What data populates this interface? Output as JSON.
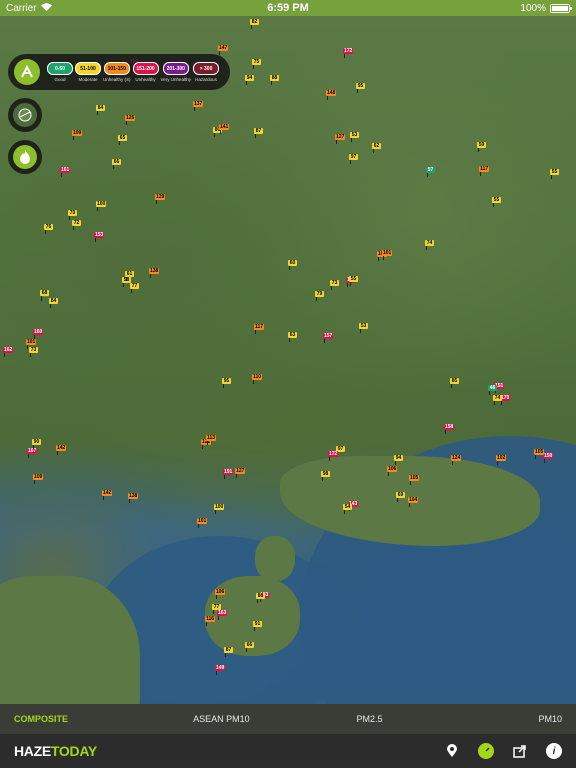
{
  "status_bar": {
    "carrier": "Carrier",
    "time": "6:59 PM",
    "battery": "100%"
  },
  "legend": {
    "items": [
      {
        "range": "0-50",
        "label": "Good",
        "color": "#1fa36b"
      },
      {
        "range": "51-100",
        "label": "Moderate",
        "color": "#f2d52a"
      },
      {
        "range": "101-150",
        "label": "Unhealthy (S)",
        "color": "#f28a1e"
      },
      {
        "range": "151-200",
        "label": "Unhealthy",
        "color": "#d8154b"
      },
      {
        "range": "201-300",
        "label": "Very Unhealthy",
        "color": "#7a1a8f"
      },
      {
        "range": "> 300",
        "label": "Hazardous",
        "color": "#7e1b2b"
      }
    ]
  },
  "map_buttons": [
    {
      "name": "satellite-layer-icon"
    },
    {
      "name": "fire-layer-icon"
    }
  ],
  "source_tabs": [
    {
      "label": "COMPOSITE",
      "active": true
    },
    {
      "label": "ASEAN PM10",
      "active": false
    },
    {
      "label": "PM2.5",
      "active": false
    },
    {
      "label": "PM10",
      "active": false
    }
  ],
  "brand": {
    "part1": "HAZE",
    "part2": "TODAY"
  },
  "bottom_icons": [
    "location-pin-icon",
    "gauge-icon",
    "share-icon",
    "info-icon"
  ],
  "markers": [
    [
      "65",
      "mod"
    ],
    [
      "147",
      "usg"
    ],
    [
      "57",
      "good"
    ],
    [
      "84",
      "mod"
    ],
    [
      "155",
      "unh"
    ],
    [
      "143",
      "unh"
    ],
    [
      "183",
      "unh"
    ],
    [
      "170",
      "unh"
    ],
    [
      "66",
      "good"
    ],
    [
      "122",
      "usg"
    ],
    [
      "85",
      "mod"
    ],
    [
      "53",
      "mod"
    ],
    [
      "97",
      "mod"
    ],
    [
      "129",
      "usg"
    ],
    [
      "79",
      "mod"
    ],
    [
      "106",
      "usg"
    ],
    [
      "149",
      "unh"
    ],
    [
      "74",
      "mod"
    ],
    [
      "160",
      "unh"
    ],
    [
      "138",
      "usg"
    ],
    [
      "84",
      "mod"
    ],
    [
      "80",
      "mod"
    ],
    [
      "104",
      "usg"
    ],
    [
      "100",
      "mod"
    ],
    [
      "55",
      "mod"
    ],
    [
      "69",
      "mod"
    ],
    [
      "77",
      "mod"
    ],
    [
      "151",
      "unh"
    ],
    [
      "162",
      "unh"
    ],
    [
      "191",
      "unh"
    ],
    [
      "137",
      "usg"
    ],
    [
      "88",
      "mod"
    ],
    [
      "74",
      "mod"
    ],
    [
      "153",
      "unh"
    ],
    [
      "60",
      "mod"
    ],
    [
      "94",
      "mod"
    ],
    [
      "87",
      "mod"
    ],
    [
      "150",
      "unh"
    ],
    [
      "142",
      "usg"
    ],
    [
      "127",
      "usg"
    ],
    [
      "153",
      "unh"
    ],
    [
      "75",
      "mod"
    ],
    [
      "62",
      "mod"
    ],
    [
      "58",
      "mod"
    ],
    [
      "63",
      "mod"
    ],
    [
      "98",
      "mod"
    ],
    [
      "91",
      "mod"
    ],
    [
      "124",
      "usg"
    ],
    [
      "167",
      "unh"
    ],
    [
      "113",
      "usg"
    ],
    [
      "161",
      "unh"
    ],
    [
      "172",
      "unh"
    ],
    [
      "148",
      "usg"
    ],
    [
      "61",
      "mod"
    ],
    [
      "53",
      "mod"
    ],
    [
      "54",
      "mod"
    ],
    [
      "106",
      "usg"
    ],
    [
      "85",
      "mod"
    ],
    [
      "90",
      "mod"
    ],
    [
      "110",
      "usg"
    ],
    [
      "145",
      "unh"
    ],
    [
      "94",
      "mod"
    ],
    [
      "127",
      "usg"
    ],
    [
      "70",
      "mod"
    ],
    [
      "101",
      "usg"
    ],
    [
      "97",
      "mod"
    ],
    [
      "88",
      "mod"
    ],
    [
      "46",
      "good"
    ],
    [
      "73",
      "mod"
    ],
    [
      "142",
      "usg"
    ],
    [
      "66",
      "mod"
    ],
    [
      "87",
      "mod"
    ],
    [
      "55",
      "mod"
    ],
    [
      "72",
      "mod"
    ],
    [
      "117",
      "usg"
    ],
    [
      "172",
      "unh"
    ],
    [
      "163",
      "unh"
    ],
    [
      "158",
      "unh"
    ],
    [
      "101",
      "usg"
    ],
    [
      "101",
      "usg"
    ],
    [
      "126",
      "usg"
    ],
    [
      "141",
      "usg"
    ],
    [
      "117",
      "usg"
    ],
    [
      "138",
      "usg"
    ],
    [
      "157",
      "unh"
    ],
    [
      "105",
      "usg"
    ],
    [
      "66",
      "mod"
    ],
    [
      "105",
      "usg"
    ],
    [
      "109",
      "usg"
    ],
    [
      "100",
      "mod"
    ],
    [
      "97",
      "mod"
    ],
    [
      "95",
      "mod"
    ],
    [
      "59",
      "mod"
    ],
    [
      "77",
      "mod"
    ],
    [
      "73",
      "mod"
    ],
    [
      "104",
      "usg"
    ],
    [
      "116",
      "usg"
    ],
    [
      "102",
      "usg"
    ],
    [
      "68",
      "mod"
    ],
    [
      "95",
      "mod"
    ],
    [
      "109",
      "usg"
    ],
    [
      "82",
      "mod"
    ],
    [
      "55",
      "mod"
    ],
    [
      "76",
      "mod"
    ]
  ]
}
